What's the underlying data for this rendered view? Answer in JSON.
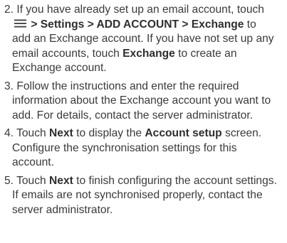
{
  "steps": [
    {
      "number": "2.",
      "lines": [
        {
          "text": "If you have already set up an email account, touch"
        },
        {
          "icon": "menu-icon",
          "sep1": " > ",
          "b1": "Settings",
          "sep2": " > ",
          "b2": "ADD ACCOUNT",
          "sep3": " > ",
          "b3": "Exchange",
          "tail": " to"
        },
        {
          "text": "add an Exchange account. If you have not set up any"
        },
        {
          "pre": "email accounts, touch ",
          "bold": "Exchange",
          "post": " to create an"
        },
        {
          "text": "Exchange account."
        }
      ]
    },
    {
      "number": "3.",
      "lines": [
        {
          "text": "Follow the instructions and enter the required"
        },
        {
          "text": "information about the Exchange account you want to"
        },
        {
          "text": "add. For details, contact the server administrator."
        }
      ]
    },
    {
      "number": "4.",
      "lines": [
        {
          "pre": "Touch ",
          "bold": "Next",
          "mid": " to display the ",
          "bold2": "Account setup",
          "post": " screen."
        },
        {
          "text": "Configure the synchronisation settings for this"
        },
        {
          "text": "account."
        }
      ]
    },
    {
      "number": "5.",
      "lines": [
        {
          "pre": "Touch ",
          "bold": "Next",
          "post": " to finish configuring the account settings."
        },
        {
          "text": "If emails are not synchronised properly, contact the"
        },
        {
          "text": "server administrator."
        }
      ]
    }
  ]
}
